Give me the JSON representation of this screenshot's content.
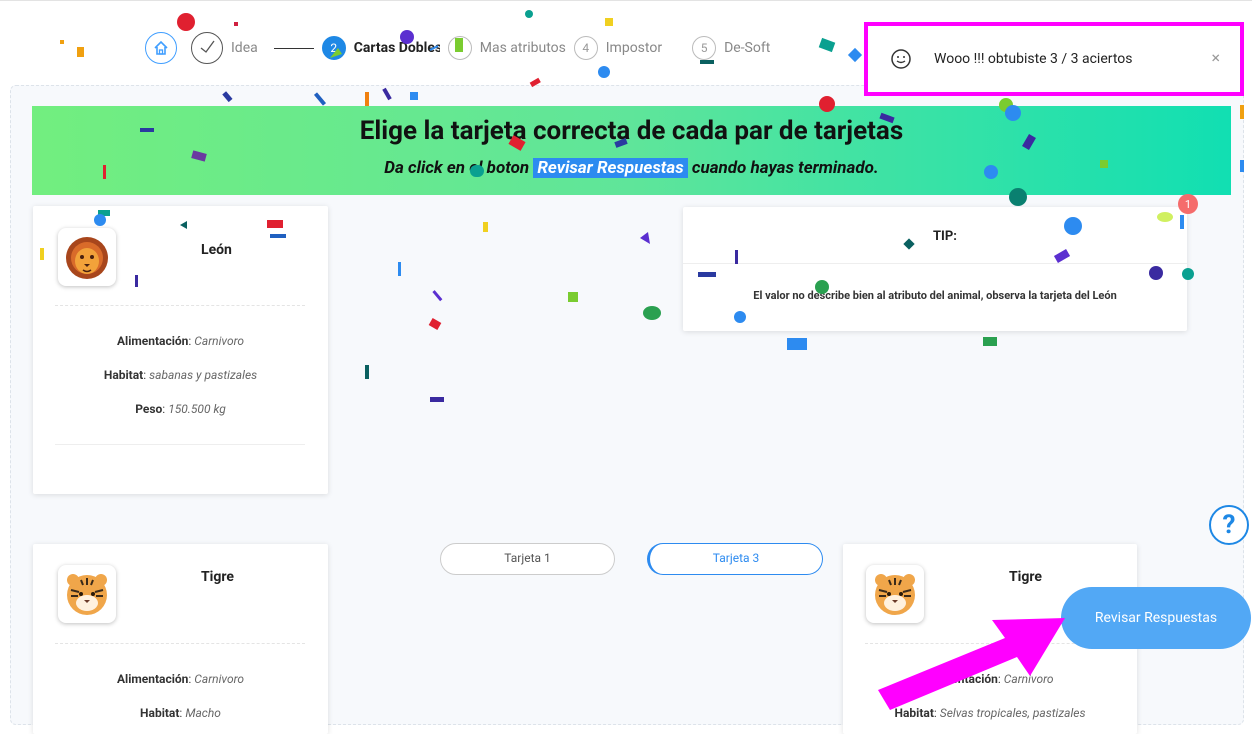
{
  "stepper": {
    "steps": [
      {
        "num": "",
        "label": "Idea"
      },
      {
        "num": "2",
        "label": "Cartas Dobles"
      },
      {
        "num": "3",
        "label": "Mas atributos"
      },
      {
        "num": "4",
        "label": "Impostor"
      },
      {
        "num": "5",
        "label": "De-Soft"
      }
    ]
  },
  "notification": {
    "message": "Wooo !!! obtubiste 3 / 3 aciertos",
    "close": "×"
  },
  "banner": {
    "title": "Elige la tarjeta correcta de cada par de tarjetas",
    "subtitle_pre": "Da click en el boton",
    "subtitle_button": "Revisar Respuestas",
    "subtitle_post": "cuando hayas terminado."
  },
  "card_lion": {
    "name": "León",
    "attr1_label": "Alimentación",
    "attr1_value": "Carnivoro",
    "attr2_label": "Habitat",
    "attr2_value": "sabanas y pastizales",
    "attr3_label": "Peso",
    "attr3_value": "150.500 kg"
  },
  "tip": {
    "title": "TIP:",
    "text": "El valor no describe bien al atributo del animal, observa la tarjeta del León",
    "badge": "1"
  },
  "card_tiger1": {
    "name": "Tigre",
    "attr1_label": "Alimentación",
    "attr1_value": "Carnivoro",
    "attr2_label": "Habitat",
    "attr2_value": "Macho"
  },
  "card_tiger2": {
    "name": "Tigre",
    "attr1_label": "Alimentación",
    "attr1_value": "Carnivoro",
    "attr2_label": "Habitat",
    "attr2_value": "Selvas tropicales, pastizales"
  },
  "choices": {
    "option1": "Tarjeta 1",
    "option2": "Tarjeta 3"
  },
  "help": "?",
  "submit_button": "Revisar Respuestas",
  "colors": {
    "accent": "#1e88e5",
    "highlight": "#ff00ff",
    "submit": "#52a8f5"
  }
}
